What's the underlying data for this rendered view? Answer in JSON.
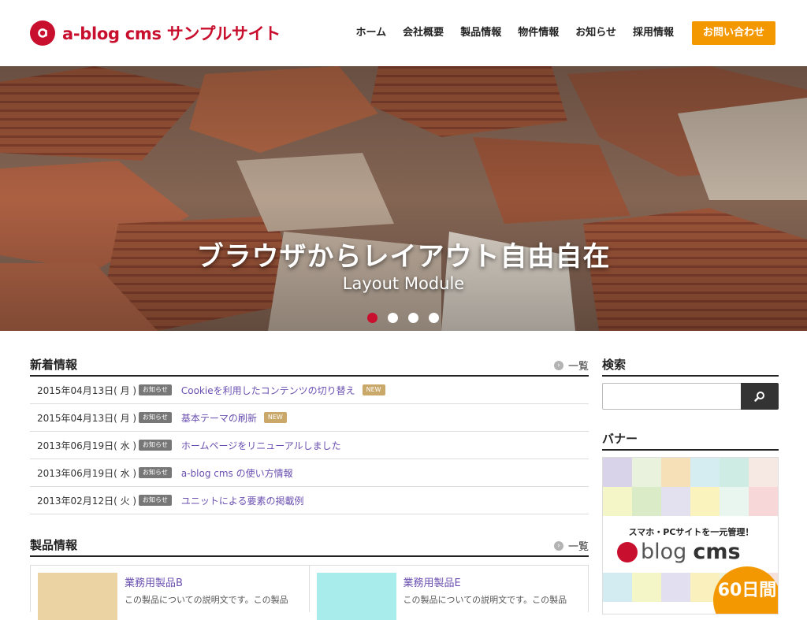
{
  "header": {
    "site_title": "a-blog cms サンプルサイト",
    "nav": [
      "ホーム",
      "会社概要",
      "製品情報",
      "物件情報",
      "お知らせ",
      "採用情報"
    ],
    "cta_label": "お問い合わせ",
    "brand_color": "#c8102e",
    "cta_color": "#f39800"
  },
  "hero": {
    "title": "ブラウザからレイアウト自由自在",
    "subtitle": "Layout Module",
    "slide_count": 4,
    "active_slide": 1
  },
  "news": {
    "title": "新着情報",
    "more_label": "一覧",
    "items": [
      {
        "date": "2015年04月13日( 月 )",
        "category": "お知らせ",
        "title": "Cookieを利用したコンテンツの切り替え",
        "new": "NEW"
      },
      {
        "date": "2015年04月13日( 月 )",
        "category": "お知らせ",
        "title": "基本テーマの刷新",
        "new": "NEW"
      },
      {
        "date": "2013年06月19日( 水 )",
        "category": "お知らせ",
        "title": "ホームページをリニューアルしました",
        "new": ""
      },
      {
        "date": "2013年06月19日( 水 )",
        "category": "お知らせ",
        "title": "a-blog cms の使い方情報",
        "new": ""
      },
      {
        "date": "2013年02月12日( 火 )",
        "category": "お知らせ",
        "title": "ユニットによる要素の掲載例",
        "new": ""
      }
    ]
  },
  "products": {
    "title": "製品情報",
    "more_label": "一覧",
    "items": [
      {
        "name": "業務用製品B",
        "desc": "この製品についての説明文です。この製品",
        "thumb_color": "#ecd3a4"
      },
      {
        "name": "業務用製品E",
        "desc": "この製品についての説明文です。この製品",
        "thumb_color": "#a8ecec"
      }
    ]
  },
  "sidebar": {
    "search_title": "検索",
    "search_value": "",
    "banner_title": "バナー",
    "banner": {
      "tagline": "スマホ・PCサイトを一元管理！",
      "logo_blog": "blog",
      "logo_cms": "cms",
      "badge": "60日間"
    }
  }
}
